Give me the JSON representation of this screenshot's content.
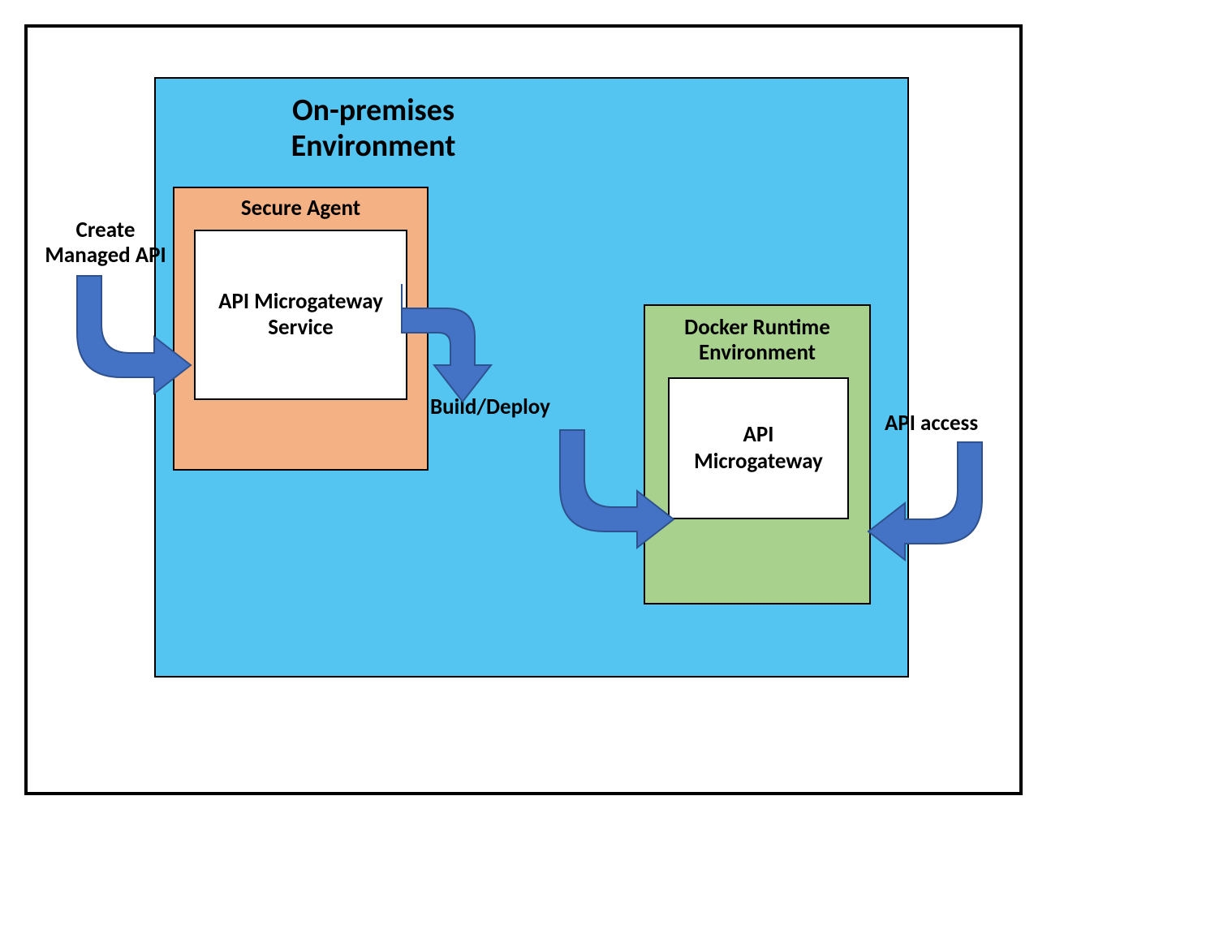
{
  "environment": {
    "title": "On-premises Environment"
  },
  "secureAgent": {
    "title": "Secure Agent",
    "service": "API Microgateway Service"
  },
  "dockerRuntime": {
    "title": "Docker Runtime Environment",
    "gateway": "API Microgateway"
  },
  "labels": {
    "create": "Create Managed API",
    "buildDeploy": "Build/Deploy",
    "apiAccess": "API access"
  },
  "colors": {
    "environment": "#54c5f0",
    "agent": "#f4b183",
    "docker": "#a9d18e",
    "arrow": "#4472c4",
    "arrowStroke": "#2f528f"
  }
}
